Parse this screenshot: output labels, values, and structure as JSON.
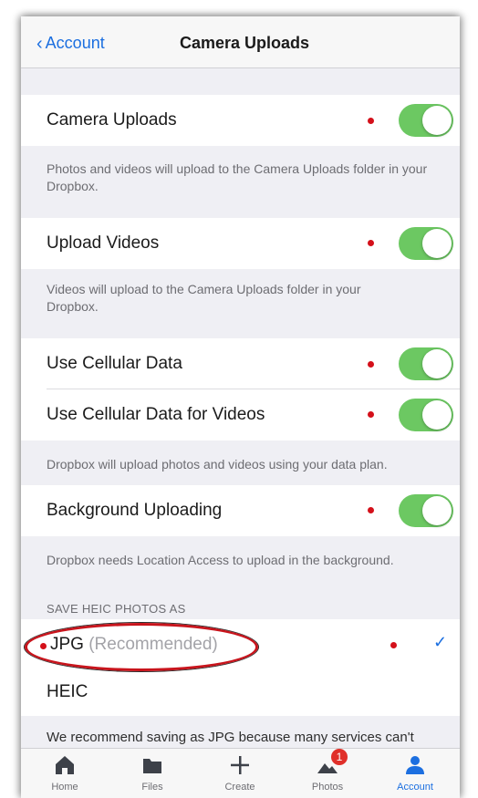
{
  "navbar": {
    "back_label": "Account",
    "title": "Camera Uploads"
  },
  "settings": {
    "camera_uploads": {
      "label": "Camera Uploads",
      "enabled": true,
      "description": "Photos and videos will upload to the Camera Uploads folder in your Dropbox."
    },
    "upload_videos": {
      "label": "Upload Videos",
      "enabled": true,
      "description": "Videos will upload to the Camera Uploads folder in your Dropbox."
    },
    "use_cellular": {
      "label": "Use Cellular Data",
      "enabled": true
    },
    "use_cellular_videos": {
      "label": "Use Cellular Data for Videos",
      "enabled": true,
      "description": "Dropbox will upload photos and videos using your data plan."
    },
    "background_uploading": {
      "label": "Background Uploading",
      "enabled": true,
      "description": "Dropbox needs Location Access to upload in the background."
    }
  },
  "heic_section": {
    "header": "SAVE HEIC PHOTOS AS",
    "options": [
      {
        "label": "JPG",
        "note": "(Recommended)",
        "selected": true
      },
      {
        "label": "HEIC",
        "selected": false
      }
    ],
    "footer": "We recommend saving as JPG because many services can't"
  },
  "tabbar": {
    "tabs": [
      {
        "label": "Home"
      },
      {
        "label": "Files"
      },
      {
        "label": "Create"
      },
      {
        "label": "Photos",
        "badge": "1"
      },
      {
        "label": "Account",
        "active": true
      }
    ]
  },
  "colors": {
    "accent": "#1c6fe0",
    "toggle_on": "#6cc862",
    "annotation_red": "#d4101a"
  }
}
